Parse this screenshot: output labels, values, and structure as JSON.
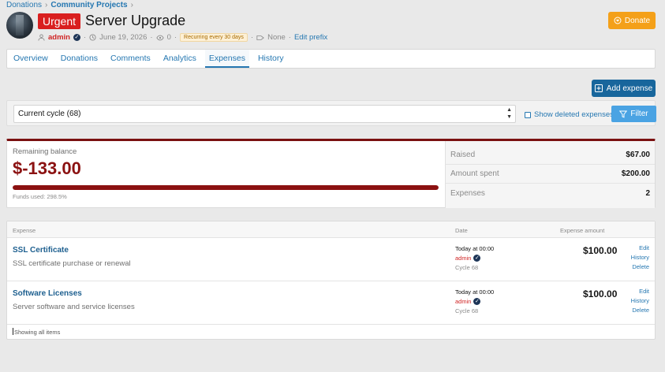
{
  "breadcrumb": {
    "items": [
      "Donations",
      "Community Projects"
    ]
  },
  "header": {
    "badge": "Urgent",
    "title": "Server Upgrade",
    "author": "admin",
    "date": "June 19, 2026",
    "views": "0",
    "recurring": "Recurring every 30 days",
    "prefix_value": "None",
    "edit_prefix": "Edit prefix",
    "donate_label": "Donate"
  },
  "tabs": [
    {
      "label": "Overview"
    },
    {
      "label": "Donations"
    },
    {
      "label": "Comments"
    },
    {
      "label": "Analytics"
    },
    {
      "label": "Expenses",
      "active": true
    },
    {
      "label": "History"
    }
  ],
  "toolbar": {
    "add_expense_label": "Add expense"
  },
  "filter": {
    "cycle_select_value": "Current cycle (68)",
    "show_deleted_label": "Show deleted expenses",
    "filter_label": "Filter"
  },
  "balance": {
    "remaining_label": "Remaining balance",
    "remaining_value": "$-133.00",
    "funds_used_label": "Funds used: 298.5%",
    "funds_used_fraction": 1.0,
    "stats": [
      {
        "label": "Raised",
        "value": "$67.00"
      },
      {
        "label": "Amount spent",
        "value": "$200.00"
      },
      {
        "label": "Expenses",
        "value": "2"
      }
    ]
  },
  "expenses": {
    "headers": {
      "expense": "Expense",
      "date": "Date",
      "amount": "Expense amount"
    },
    "rows": [
      {
        "name": "SSL Certificate",
        "description": "SSL certificate purchase or renewal",
        "date": "Today at 00:00",
        "author": "admin",
        "cycle": "Cycle 68",
        "amount": "$100.00",
        "actions": [
          "Edit",
          "History",
          "Delete"
        ]
      },
      {
        "name": "Software Licenses",
        "description": "Server software and service licenses",
        "date": "Today at 00:00",
        "author": "admin",
        "cycle": "Cycle 68",
        "amount": "$100.00",
        "actions": [
          "Edit",
          "History",
          "Delete"
        ]
      }
    ],
    "footer": "Showing all items"
  },
  "colors": {
    "accent": "#2577b1",
    "danger": "#8b1111",
    "donate": "#f4a019",
    "urgent": "#d91f1f"
  }
}
